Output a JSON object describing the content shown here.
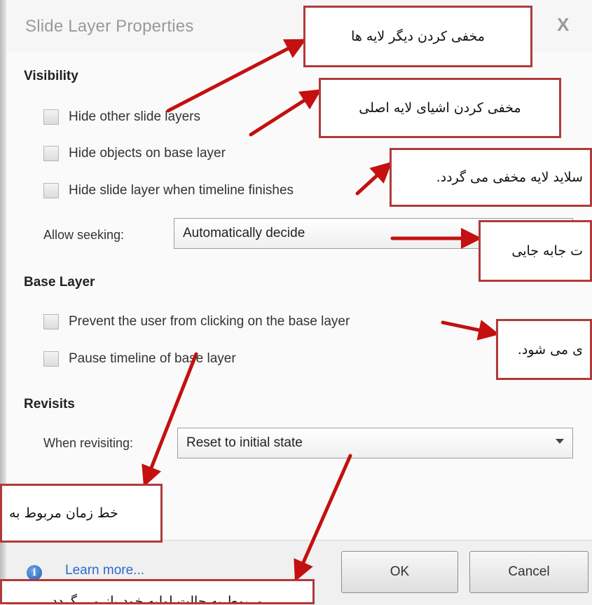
{
  "dialog": {
    "title": "Slide Layer Properties",
    "close_symbol": "X"
  },
  "visibility": {
    "heading": "Visibility",
    "options": [
      {
        "label": "Hide other slide layers",
        "checked": false
      },
      {
        "label": "Hide objects on base layer",
        "checked": false
      },
      {
        "label": "Hide slide layer when timeline finishes",
        "checked": false
      }
    ],
    "seeking_label": "Allow seeking:",
    "seeking_value": "Automatically decide"
  },
  "base_layer": {
    "heading": "Base Layer",
    "options": [
      {
        "label": "Prevent the user from clicking on the base layer",
        "checked": false
      },
      {
        "label": "Pause timeline of base layer",
        "checked": false
      }
    ]
  },
  "revisits": {
    "heading": "Revisits",
    "label": "When revisiting:",
    "value": "Reset to initial state"
  },
  "footer": {
    "info_symbol": "i",
    "learn_more": "Learn more...",
    "ok": "OK",
    "cancel": "Cancel"
  },
  "annotations": [
    "مخفی کردن دیگر لایه ها",
    "مخفی کردن اشیای لایه اصلی",
    "سلاید لایه مخفی می گردد.",
    "ت جابه جایی",
    "ی می شود.",
    "خط زمان مربوط به",
    "مربوط به حالت اولیه خود باز می گردد"
  ],
  "colors": {
    "annotation_border": "#b03a3a",
    "arrow": "#c41010",
    "link": "#2a6ad0"
  }
}
